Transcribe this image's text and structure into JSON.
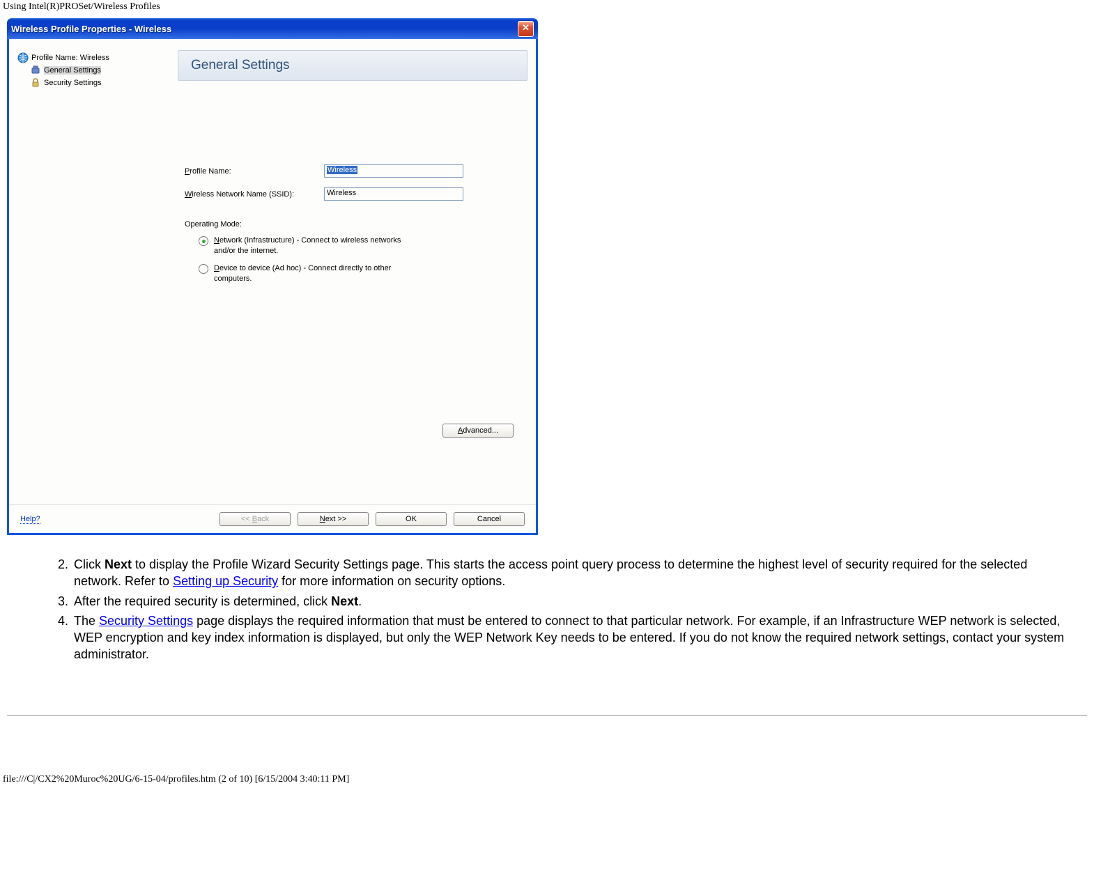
{
  "page_header": "Using Intel(R)PROSet/Wireless Profiles",
  "dialog": {
    "title": "Wireless Profile Properties  -  Wireless",
    "sidebar": {
      "profile_label": "Profile Name: Wireless",
      "general_settings": "General Settings",
      "security_settings": "Security Settings"
    },
    "panel_title": "General Settings",
    "form": {
      "profile_name_label": "Profile Name:",
      "profile_name_value": "Wireless",
      "ssid_label": "Wireless Network Name (SSID):",
      "ssid_value": "Wireless",
      "operating_mode_label": "Operating Mode:",
      "radio_infra": "Network (Infrastructure) - Connect to wireless networks and/or the internet.",
      "radio_adhoc": "Device to device (Ad hoc) - Connect directly to other computers."
    },
    "buttons": {
      "advanced": "Advanced...",
      "back": "<< Back",
      "next": "Next >>",
      "ok": "OK",
      "cancel": "Cancel",
      "help": "Help?"
    }
  },
  "doc": {
    "item2_a": "Click ",
    "item2_b": "Next",
    "item2_c": " to display the Profile Wizard Security Settings page. This starts the access point query process to determine the highest level of security required for the selected network. Refer to ",
    "item2_link": "Setting up Security",
    "item2_d": " for more information on security options.",
    "item3_a": "After the required security is determined, click ",
    "item3_b": "Next",
    "item3_c": ".",
    "item4_a": "The ",
    "item4_link": "Security Settings",
    "item4_b": " page displays the required information that must be entered to connect to that particular network. For example, if an Infrastructure WEP network is selected, WEP encryption and key index information is displayed, but only the WEP Network Key needs to be entered. If you do not know the required network settings, contact your system administrator."
  },
  "footer": "file:///C|/CX2%20Muroc%20UG/6-15-04/profiles.htm (2 of 10) [6/15/2004 3:40:11 PM]"
}
